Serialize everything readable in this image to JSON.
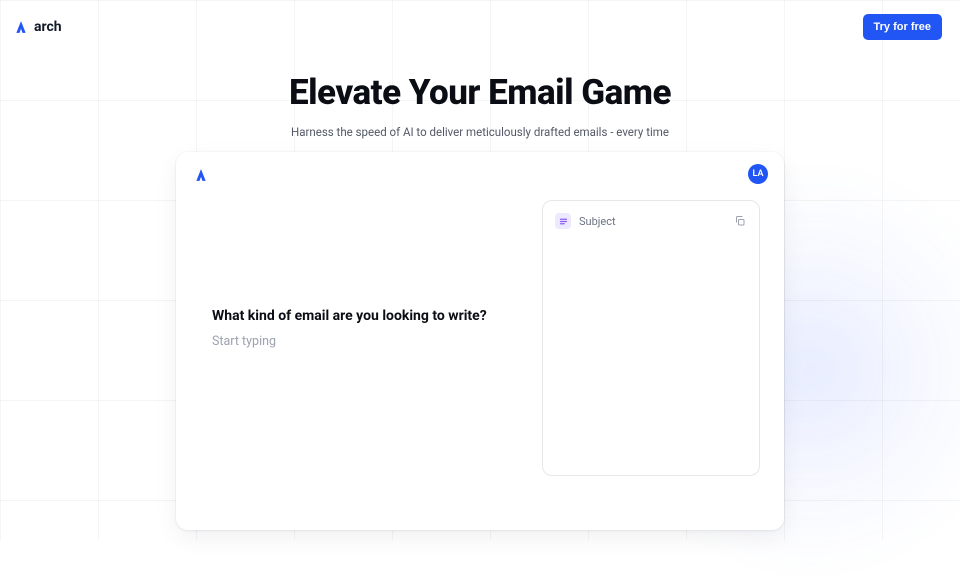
{
  "brand": {
    "name": "arch"
  },
  "header": {
    "cta_label": "Try for free"
  },
  "hero": {
    "title": "Elevate Your Email Game",
    "subtitle": "Harness the speed of AI to deliver meticulously drafted emails - every time"
  },
  "panel": {
    "avatar_initials": "LA",
    "prompt_question": "What kind of email are you looking to write?",
    "input_placeholder": "Start typing",
    "input_value": ""
  },
  "preview": {
    "subject_label": "Subject"
  },
  "colors": {
    "accent": "#2156f5"
  }
}
